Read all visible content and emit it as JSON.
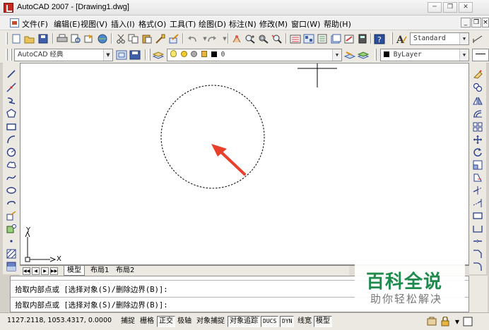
{
  "window": {
    "title": "AutoCAD 2007 - [Drawing1.dwg]",
    "controls": [
      "minimize",
      "restore",
      "close"
    ]
  },
  "menu": {
    "items": [
      "文件(F)",
      "编辑(E)",
      "视图(V)",
      "插入(I)",
      "格式(O)",
      "工具(T)",
      "绘图(D)",
      "标注(N)",
      "修改(M)",
      "窗口(W)",
      "帮助(H)"
    ]
  },
  "toolbars": {
    "text_style": "Standard",
    "workspace": "AutoCAD 经典",
    "layer": "0",
    "color": "ByLayer"
  },
  "layout_tabs": {
    "tabs": [
      "模型",
      "布局1",
      "布局2"
    ],
    "active": "模型"
  },
  "command_line": {
    "lines": [
      "拾取内部点或 [选择对象(S)/删除边界(B)]:",
      "拾取内部点或 [选择对象(S)/删除边界(B)]:"
    ]
  },
  "ucs": {
    "x_label": "X",
    "y_label": "Y"
  },
  "status": {
    "coordinates": "1127.2118, 1053.4317, 0.0000",
    "buttons": [
      {
        "label": "捕捉",
        "on": false
      },
      {
        "label": "栅格",
        "on": false
      },
      {
        "label": "正交",
        "on": true
      },
      {
        "label": "极轴",
        "on": false
      },
      {
        "label": "对象捕捉",
        "on": false
      },
      {
        "label": "对象追踪",
        "on": true
      },
      {
        "label": "DUCS",
        "on": true
      },
      {
        "label": "DYN",
        "on": true
      },
      {
        "label": "线宽",
        "on": false
      },
      {
        "label": "模型",
        "on": true
      }
    ]
  },
  "watermark": {
    "title": "百科全说",
    "subtitle": "助你轻松解决"
  },
  "colors": {
    "arrow": "#e8402a",
    "watermark_green": "#1e8a4c"
  }
}
